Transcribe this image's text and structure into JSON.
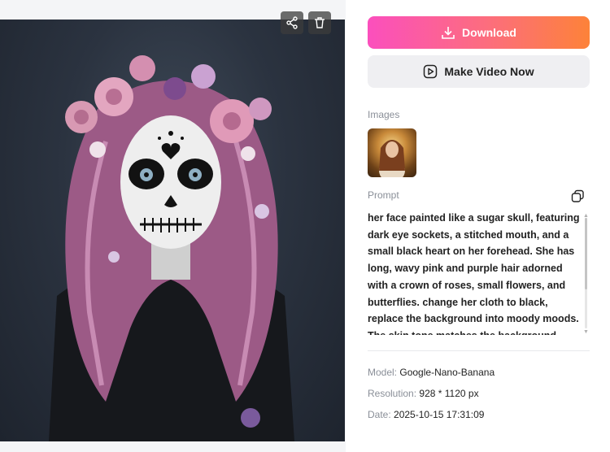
{
  "actions": {
    "download_label": "Download",
    "make_video_label": "Make Video Now"
  },
  "images": {
    "heading": "Images"
  },
  "prompt": {
    "heading": "Prompt",
    "text": "her face painted like a sugar skull, featuring dark eye sockets, a stitched mouth, and a small black heart on her forehead. She has long, wavy pink and purple hair adorned with a crown of roses, small flowers, and butterflies. change her cloth to black, replace the background into moody moods. The skin tone matches the background"
  },
  "meta": {
    "model_key": "Model:",
    "model_value": "Google-Nano-Banana",
    "resolution_key": "Resolution:",
    "resolution_value": "928 * 1120 px",
    "date_key": "Date:",
    "date_value": "2025-10-15 17:31:09"
  },
  "colors": {
    "download_gradient_start": "#fb4fbd",
    "download_gradient_end": "#fd8239"
  },
  "icons": [
    "share-icon",
    "trash-icon",
    "download-icon",
    "play-icon",
    "copy-icon"
  ]
}
